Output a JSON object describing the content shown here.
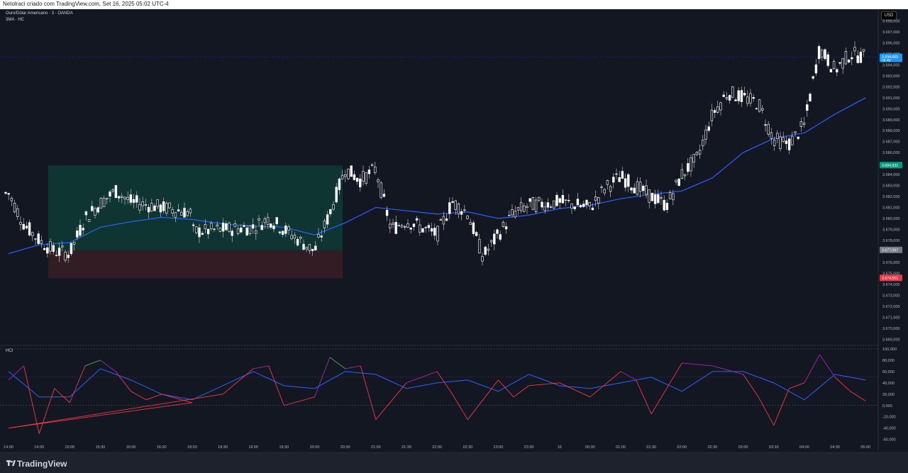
{
  "header": {
    "watermark_line": "Netolraci criado com TradingView.com, Set 16, 2025 05:02 UTC-4",
    "symbol_line": "Ouro/Dólar Americano · 3 · OANDA",
    "indicator_line": "3MA · HC",
    "sub_indicator": "HCI",
    "currency": "USD"
  },
  "footer": {
    "brand": "TradingView"
  },
  "colors": {
    "background": "#131722",
    "bull_candle": "#ffffff",
    "bear_candle": "#ffffff",
    "ma_line": "#2962ff",
    "box_upper": "#0f3b36",
    "box_lower": "#3a1e26",
    "osc_red": "#f23645",
    "osc_purple": "#9c27b0",
    "osc_green": "#4caf50",
    "osc_signal": "#2962ff"
  },
  "chart_data": [
    {
      "type": "line",
      "title": "Ouro/Dólar Americano · 3 · OANDA",
      "x_ticks": [
        "14:00",
        "14:30",
        "15:00",
        "15:30",
        "16:00",
        "16:30",
        "18:03",
        "18:30",
        "19:00",
        "19:30",
        "20:00",
        "20:30",
        "21:00",
        "21:30",
        "22:00",
        "22:30",
        "23:00",
        "23:30",
        "16",
        "00:30",
        "01:00",
        "01:30",
        "02:00",
        "02:30",
        "03:00",
        "03:30",
        "04:00",
        "04:30",
        "05:00"
      ],
      "y_ticks": [
        "3.698,000",
        "3.697,000",
        "3.696,000",
        "3.695,000",
        "3.694,000",
        "3.693,000",
        "3.692,000",
        "3.691,000",
        "3.690,000",
        "3.689,000",
        "3.688,000",
        "3.687,000",
        "3.686,000",
        "3.685,000",
        "3.684,000",
        "3.683,000",
        "3.682,000",
        "3.681,000",
        "3.680,000",
        "3.679,000",
        "3.678,000",
        "3.677,000",
        "3.676,000",
        "3.675,000",
        "3.674,000",
        "3.673,000",
        "3.672,000",
        "3.671,000",
        "3.670,000",
        "3.669,000"
      ],
      "ylim": [
        3668.5,
        3699
      ],
      "price_labels": [
        {
          "text": "3.694,665",
          "sub": "05:40",
          "value": 3694.7,
          "color": "#2196f3"
        },
        {
          "text": "3.684,832",
          "value": 3684.83,
          "color": "#089981"
        },
        {
          "text": "3.677,097",
          "value": 3677.1,
          "color": "#787b86"
        },
        {
          "text": "3.674,551",
          "value": 3674.55,
          "color": "#f23645"
        }
      ],
      "price_series": [
        {
          "t": "14:00",
          "price": 3682.3
        },
        {
          "t": "14:15",
          "price": 3679.5
        },
        {
          "t": "14:30",
          "price": 3678.0
        },
        {
          "t": "14:45",
          "price": 3677.0
        },
        {
          "t": "15:00",
          "price": 3676.8
        },
        {
          "t": "15:15",
          "price": 3680.0
        },
        {
          "t": "15:30",
          "price": 3681.4
        },
        {
          "t": "15:45",
          "price": 3682.5
        },
        {
          "t": "16:00",
          "price": 3681.5
        },
        {
          "t": "16:30",
          "price": 3681.0
        },
        {
          "t": "18:03",
          "price": 3680.5
        },
        {
          "t": "18:15",
          "price": 3677.5
        },
        {
          "t": "18:30",
          "price": 3679.0
        },
        {
          "t": "19:00",
          "price": 3679.2
        },
        {
          "t": "19:15",
          "price": 3680.0
        },
        {
          "t": "19:30",
          "price": 3679.0
        },
        {
          "t": "19:45",
          "price": 3678.0
        },
        {
          "t": "20:00",
          "price": 3677.0
        },
        {
          "t": "20:15",
          "price": 3680.5
        },
        {
          "t": "20:30",
          "price": 3684.5
        },
        {
          "t": "20:45",
          "price": 3683.5
        },
        {
          "t": "21:00",
          "price": 3684.5
        },
        {
          "t": "21:15",
          "price": 3679.0
        },
        {
          "t": "21:30",
          "price": 3679.8
        },
        {
          "t": "22:00",
          "price": 3678.5
        },
        {
          "t": "22:15",
          "price": 3681.5
        },
        {
          "t": "22:30",
          "price": 3680.5
        },
        {
          "t": "22:45",
          "price": 3676.5
        },
        {
          "t": "23:00",
          "price": 3678.5
        },
        {
          "t": "23:15",
          "price": 3680.5
        },
        {
          "t": "23:30",
          "price": 3681.2
        },
        {
          "t": "16",
          "price": 3681.5
        },
        {
          "t": "00:30",
          "price": 3681.0
        },
        {
          "t": "00:45",
          "price": 3682.8
        },
        {
          "t": "01:00",
          "price": 3683.8
        },
        {
          "t": "01:30",
          "price": 3682.0
        },
        {
          "t": "01:45",
          "price": 3681.2
        },
        {
          "t": "02:00",
          "price": 3684.0
        },
        {
          "t": "02:15",
          "price": 3685.5
        },
        {
          "t": "02:30",
          "price": 3689.5
        },
        {
          "t": "02:45",
          "price": 3691.5
        },
        {
          "t": "03:00",
          "price": 3691.0
        },
        {
          "t": "03:15",
          "price": 3690.5
        },
        {
          "t": "03:30",
          "price": 3687.2
        },
        {
          "t": "03:45",
          "price": 3686.8
        },
        {
          "t": "04:00",
          "price": 3688.5
        },
        {
          "t": "04:15",
          "price": 3695.5
        },
        {
          "t": "04:30",
          "price": 3693.5
        },
        {
          "t": "04:45",
          "price": 3695.0
        },
        {
          "t": "05:00",
          "price": 3694.7
        }
      ],
      "ma_series": [
        {
          "t": "14:00",
          "value": 3676.8
        },
        {
          "t": "14:30",
          "value": 3677.6
        },
        {
          "t": "15:00",
          "value": 3677.8
        },
        {
          "t": "15:30",
          "value": 3679.2
        },
        {
          "t": "16:00",
          "value": 3679.7
        },
        {
          "t": "16:30",
          "value": 3680.1
        },
        {
          "t": "18:03",
          "value": 3679.9
        },
        {
          "t": "18:30",
          "value": 3679.5
        },
        {
          "t": "19:00",
          "value": 3679.3
        },
        {
          "t": "19:30",
          "value": 3679.2
        },
        {
          "t": "20:00",
          "value": 3678.5
        },
        {
          "t": "20:30",
          "value": 3679.6
        },
        {
          "t": "21:00",
          "value": 3681.0
        },
        {
          "t": "21:30",
          "value": 3680.7
        },
        {
          "t": "22:00",
          "value": 3680.4
        },
        {
          "t": "22:30",
          "value": 3680.6
        },
        {
          "t": "23:00",
          "value": 3680.0
        },
        {
          "t": "23:30",
          "value": 3680.3
        },
        {
          "t": "16",
          "value": 3680.9
        },
        {
          "t": "00:30",
          "value": 3681.2
        },
        {
          "t": "01:00",
          "value": 3681.8
        },
        {
          "t": "01:30",
          "value": 3682.2
        },
        {
          "t": "02:00",
          "value": 3682.5
        },
        {
          "t": "02:30",
          "value": 3683.7
        },
        {
          "t": "03:00",
          "value": 3686.0
        },
        {
          "t": "03:30",
          "value": 3687.3
        },
        {
          "t": "04:00",
          "value": 3687.8
        },
        {
          "t": "04:30",
          "value": 3689.5
        },
        {
          "t": "05:00",
          "value": 3691.0
        }
      ]
    },
    {
      "type": "line",
      "title": "HCI",
      "y_ticks": [
        "100,000",
        "80,000",
        "60,000",
        "40,000",
        "20,000",
        "0,000",
        "-20,000",
        "-40,000",
        "-60,000"
      ],
      "ylim": [
        -63,
        105
      ],
      "levels": [
        100,
        50,
        0
      ],
      "osc_series": [
        {
          "t": "14:00",
          "value": 45
        },
        {
          "t": "14:15",
          "value": 70
        },
        {
          "t": "14:30",
          "value": -50
        },
        {
          "t": "14:45",
          "value": 30
        },
        {
          "t": "15:00",
          "value": 5
        },
        {
          "t": "15:15",
          "value": 70
        },
        {
          "t": "15:30",
          "value": 80
        },
        {
          "t": "15:45",
          "value": 60
        },
        {
          "t": "16:00",
          "value": 25
        },
        {
          "t": "16:15",
          "value": 10
        },
        {
          "t": "16:30",
          "value": 20
        },
        {
          "t": "18:03",
          "value": 5
        },
        {
          "t": "18:15",
          "value": -40
        },
        {
          "t": "18:30",
          "value": 20
        },
        {
          "t": "19:00",
          "value": 65
        },
        {
          "t": "19:15",
          "value": 70
        },
        {
          "t": "19:30",
          "value": 0
        },
        {
          "t": "20:00",
          "value": 15
        },
        {
          "t": "20:15",
          "value": 85
        },
        {
          "t": "20:30",
          "value": 65
        },
        {
          "t": "20:45",
          "value": 70
        },
        {
          "t": "21:00",
          "value": -25
        },
        {
          "t": "21:30",
          "value": 40
        },
        {
          "t": "22:00",
          "value": 60
        },
        {
          "t": "22:15",
          "value": 20
        },
        {
          "t": "22:30",
          "value": -25
        },
        {
          "t": "23:00",
          "value": 45
        },
        {
          "t": "23:15",
          "value": 15
        },
        {
          "t": "23:30",
          "value": 35
        },
        {
          "t": "16",
          "value": 40
        },
        {
          "t": "00:30",
          "value": 15
        },
        {
          "t": "01:00",
          "value": 60
        },
        {
          "t": "01:15",
          "value": 45
        },
        {
          "t": "01:30",
          "value": -15
        },
        {
          "t": "02:00",
          "value": 75
        },
        {
          "t": "02:30",
          "value": 70
        },
        {
          "t": "03:00",
          "value": 55
        },
        {
          "t": "03:15",
          "value": 15
        },
        {
          "t": "03:30",
          "value": -35
        },
        {
          "t": "03:45",
          "value": 30
        },
        {
          "t": "04:00",
          "value": 40
        },
        {
          "t": "04:15",
          "value": 90
        },
        {
          "t": "04:30",
          "value": 50
        },
        {
          "t": "04:45",
          "value": 25
        },
        {
          "t": "05:00",
          "value": 8
        }
      ],
      "signal_series": [
        {
          "t": "14:00",
          "value": 60
        },
        {
          "t": "14:30",
          "value": 15
        },
        {
          "t": "15:00",
          "value": 15
        },
        {
          "t": "15:30",
          "value": 65
        },
        {
          "t": "16:00",
          "value": 45
        },
        {
          "t": "16:30",
          "value": 20
        },
        {
          "t": "18:03",
          "value": 10
        },
        {
          "t": "18:30",
          "value": 35
        },
        {
          "t": "19:00",
          "value": 60
        },
        {
          "t": "19:30",
          "value": 35
        },
        {
          "t": "20:00",
          "value": 30
        },
        {
          "t": "20:30",
          "value": 60
        },
        {
          "t": "21:00",
          "value": 55
        },
        {
          "t": "21:30",
          "value": 30
        },
        {
          "t": "22:00",
          "value": 40
        },
        {
          "t": "22:30",
          "value": 45
        },
        {
          "t": "23:00",
          "value": 25
        },
        {
          "t": "23:30",
          "value": 55
        },
        {
          "t": "16",
          "value": 35
        },
        {
          "t": "00:30",
          "value": 30
        },
        {
          "t": "01:00",
          "value": 40
        },
        {
          "t": "01:30",
          "value": 50
        },
        {
          "t": "02:00",
          "value": 25
        },
        {
          "t": "02:30",
          "value": 60
        },
        {
          "t": "03:00",
          "value": 60
        },
        {
          "t": "03:30",
          "value": 40
        },
        {
          "t": "04:00",
          "value": 10
        },
        {
          "t": "04:30",
          "value": 55
        },
        {
          "t": "05:00",
          "value": 45
        }
      ]
    }
  ]
}
